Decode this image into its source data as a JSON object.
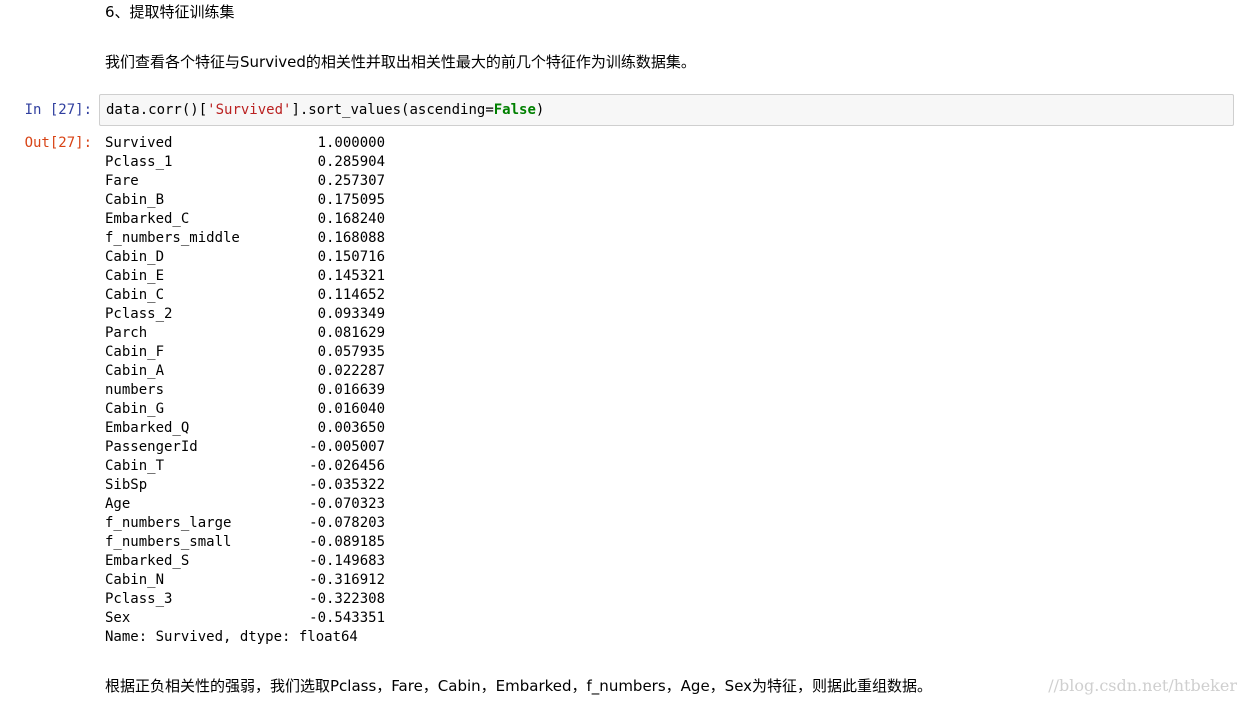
{
  "markdown": {
    "heading": "6、提取特征训练集",
    "intro": "我们查看各个特征与Survived的相关性并取出相关性最大的前几个特征作为训练数据集。",
    "conclusion": "根据正负相关性的强弱，我们选取Pclass，Fare，Cabin，Embarked，f_numbers，Age，Sex为特征，则据此重组数据。"
  },
  "cell": {
    "in_prompt": "In [27]:",
    "out_prompt": "Out[27]:",
    "code": {
      "part1": "data.corr()[",
      "string": "'Survived'",
      "part2": "].sort_values(ascending=",
      "keyword": "False",
      "part3": ")"
    }
  },
  "output": {
    "rows": [
      {
        "name": "Survived",
        "value": "1.000000"
      },
      {
        "name": "Pclass_1",
        "value": "0.285904"
      },
      {
        "name": "Fare",
        "value": "0.257307"
      },
      {
        "name": "Cabin_B",
        "value": "0.175095"
      },
      {
        "name": "Embarked_C",
        "value": "0.168240"
      },
      {
        "name": "f_numbers_middle",
        "value": "0.168088"
      },
      {
        "name": "Cabin_D",
        "value": "0.150716"
      },
      {
        "name": "Cabin_E",
        "value": "0.145321"
      },
      {
        "name": "Cabin_C",
        "value": "0.114652"
      },
      {
        "name": "Pclass_2",
        "value": "0.093349"
      },
      {
        "name": "Parch",
        "value": "0.081629"
      },
      {
        "name": "Cabin_F",
        "value": "0.057935"
      },
      {
        "name": "Cabin_A",
        "value": "0.022287"
      },
      {
        "name": "numbers",
        "value": "0.016639"
      },
      {
        "name": "Cabin_G",
        "value": "0.016040"
      },
      {
        "name": "Embarked_Q",
        "value": "0.003650"
      },
      {
        "name": "PassengerId",
        "value": "-0.005007"
      },
      {
        "name": "Cabin_T",
        "value": "-0.026456"
      },
      {
        "name": "SibSp",
        "value": "-0.035322"
      },
      {
        "name": "Age",
        "value": "-0.070323"
      },
      {
        "name": "f_numbers_large",
        "value": "-0.078203"
      },
      {
        "name": "f_numbers_small",
        "value": "-0.089185"
      },
      {
        "name": "Embarked_S",
        "value": "-0.149683"
      },
      {
        "name": "Cabin_N",
        "value": "-0.316912"
      },
      {
        "name": "Pclass_3",
        "value": "-0.322308"
      },
      {
        "name": "Sex",
        "value": "-0.543351"
      }
    ],
    "footer": "Name: Survived, dtype: float64"
  },
  "watermark": "//blog.csdn.net/htbeker",
  "colors": {
    "in_prompt": "#303f9f",
    "out_prompt": "#d84315",
    "string": "#ba2121",
    "keyword": "#008000",
    "input_bg": "#f7f7f7",
    "input_border": "#cfcfcf"
  }
}
